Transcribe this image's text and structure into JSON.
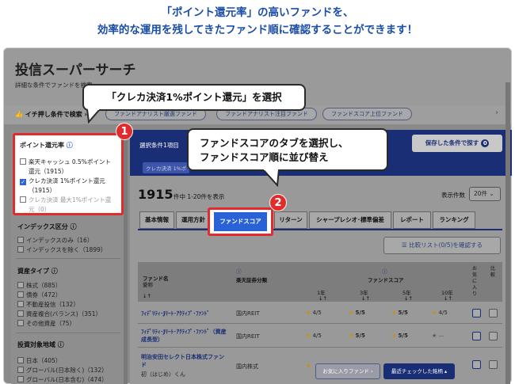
{
  "headline": {
    "line1": "「ポイント還元率」の高いファンドを、",
    "line2": "効率的な運用を残してきたファンド順に確認することができます！"
  },
  "app": {
    "title": "投信スーパーサーチ",
    "subtitle": "詳細な条件でファンドを検索"
  },
  "pushbar": {
    "label": "イチ押し条件で検索",
    "chips": [
      "ファンドアナリスト厳選ファンド",
      "ファンドアナリスト注目ファンド",
      "ファンドスコア上位ファンド"
    ]
  },
  "filters": {
    "point_title": "ポイント還元率",
    "point_items": [
      "楽天キャッシュ 0.5%ポイント",
      "還元（1915）",
      "クレカ決済 1%ポイント還元",
      "（1915）",
      "クレカ決済 最大1%ポイント還",
      "元（0）"
    ],
    "index_title": "インデックス区分",
    "index_items": [
      "インデックスのみ（16）",
      "インデックスを除く（1899）"
    ],
    "asset_title": "資産タイプ",
    "asset_items": [
      "株式（885）",
      "債券（472）",
      "不動産投信（132）",
      "資産複合(バランス)（351）",
      "その他資産（75）"
    ],
    "region_title": "投資対象地域",
    "region_items": [
      "日本（405）",
      "グローバル(日本除く)（132）",
      "グローバル(日本含む)（474）"
    ]
  },
  "band": {
    "condition_label": "選択条件1項目",
    "tag": "クレカ決済 1%ポ",
    "save_label": "保存した条件で探す",
    "save_count": "0"
  },
  "callout1": "「クレカ決済1%ポイント還元」を選択",
  "callout2": {
    "line1": "ファンドスコアのタブを選択し、",
    "line2": "ファンドスコア順に並び替え"
  },
  "badges": {
    "one": "1",
    "two": "2"
  },
  "results": {
    "count": "1915",
    "count_sub": "件中 1-20件を表示",
    "per_page_label": "表示件数",
    "per_page_value": "20件 ⌄"
  },
  "tabs": [
    "基本情報",
    "運用方針",
    "ファンドスコア",
    "リターン",
    "シャープレシオ･標準偏差",
    "レポート",
    "ランキング"
  ],
  "compare_label": "比較リスト(0/5)を確認する",
  "table": {
    "col_name": "ファンド名",
    "col_name_sub": "愛称",
    "col_class": "楽天証券分類",
    "col_score": "ファンドスコア",
    "periods": [
      "1年",
      "3年",
      "5年",
      "10年"
    ],
    "col_fav": "お気に入り",
    "col_cmp": "比較",
    "rows": [
      {
        "name": "ﾌｨﾃﾞﾘﾃｨ･Jﾘｰﾄ･ｱｸﾃｨﾌﾞ･ﾌｧﾝﾄﾞ",
        "name2": "",
        "cls": "国内REIT",
        "s1": "4/5",
        "s3": "5/5",
        "s5": "5/5",
        "s10": "4/5"
      },
      {
        "name": "ﾌｨﾃﾞﾘﾃｨ･Jﾘｰﾄ･ｱｸﾃｨﾌﾞ･ﾌｧﾝﾄﾞ（資産",
        "name2": "成長型）",
        "cls": "国内REIT",
        "s1": "4/5",
        "s3": "5/5",
        "s5": "5/5",
        "s10": "—"
      },
      {
        "name": "明治安田セレクト日本株式ファン",
        "name2": "ド",
        "name3": "初（はじめ）くん",
        "cls": "国内株式",
        "s1": "",
        "s3": "",
        "s5": "",
        "s10": ""
      }
    ]
  },
  "bottom": {
    "fav": "お気に入りファンド ›",
    "recent": "最近チェックした銘柄 ▴"
  },
  "colors": {
    "accent": "#e02c2c",
    "navy": "#1a2e75",
    "headline": "#1a4ea8"
  }
}
